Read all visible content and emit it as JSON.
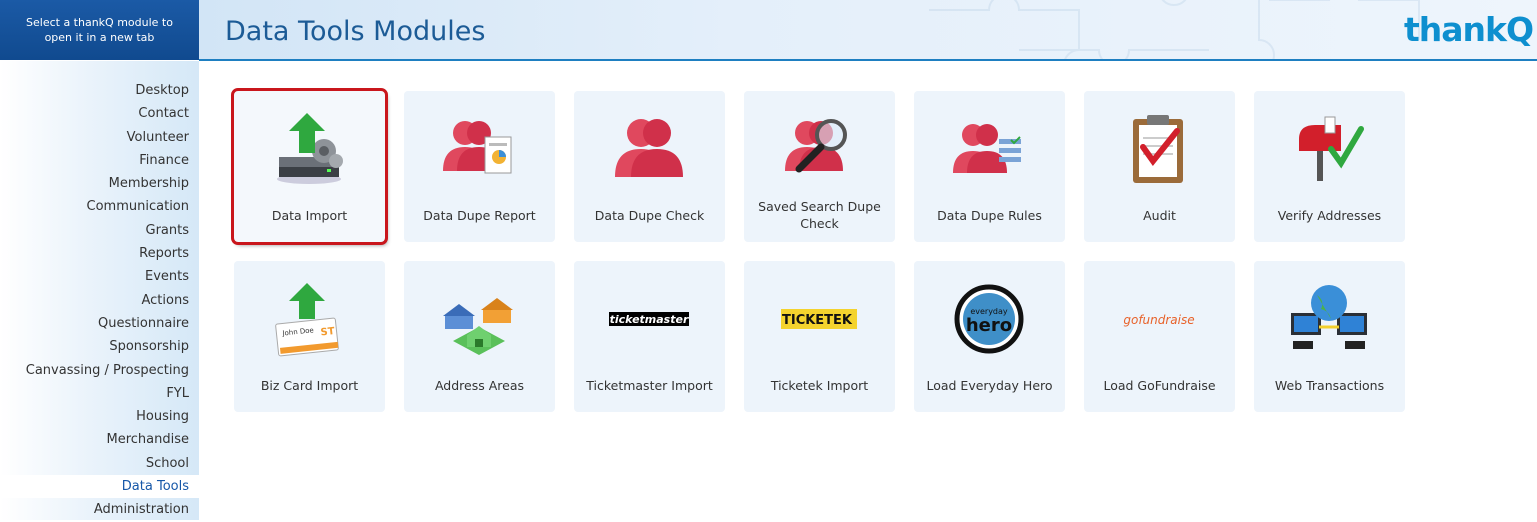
{
  "header": {
    "hint": "Select a thankQ module to open it in a new tab",
    "title": "Data Tools Modules",
    "logo": "thankQ"
  },
  "sidebar": {
    "items": [
      {
        "label": "Desktop"
      },
      {
        "label": "Contact"
      },
      {
        "label": "Volunteer"
      },
      {
        "label": "Finance"
      },
      {
        "label": "Membership"
      },
      {
        "label": "Communication"
      },
      {
        "label": "Grants"
      },
      {
        "label": "Reports"
      },
      {
        "label": "Events"
      },
      {
        "label": "Actions"
      },
      {
        "label": "Questionnaire"
      },
      {
        "label": "Sponsorship"
      },
      {
        "label": "Canvassing / Prospecting"
      },
      {
        "label": "FYL"
      },
      {
        "label": "Housing"
      },
      {
        "label": "Merchandise"
      },
      {
        "label": "School"
      },
      {
        "label": "Data Tools",
        "active": true
      },
      {
        "label": "Administration"
      }
    ]
  },
  "modules": [
    {
      "label": "Data Import",
      "icon": "data-import-icon",
      "selected": true
    },
    {
      "label": "Data Dupe Report",
      "icon": "dupe-report-icon"
    },
    {
      "label": "Data Dupe Check",
      "icon": "dupe-check-icon"
    },
    {
      "label": "Saved Search Dupe Check",
      "icon": "saved-search-icon"
    },
    {
      "label": "Data Dupe Rules",
      "icon": "dupe-rules-icon"
    },
    {
      "label": "Audit",
      "icon": "clipboard-check-icon"
    },
    {
      "label": "Verify Addresses",
      "icon": "mailbox-check-icon"
    },
    {
      "label": "Biz Card Import",
      "icon": "business-card-icon"
    },
    {
      "label": "Address Areas",
      "icon": "houses-icon"
    },
    {
      "label": "Ticketmaster Import",
      "icon": "ticketmaster-logo",
      "logo_text": "ticketmaster"
    },
    {
      "label": "Ticketek Import",
      "icon": "ticketek-logo",
      "logo_text": "TICKETEK"
    },
    {
      "label": "Load Everyday Hero",
      "icon": "everyday-hero-logo",
      "logo_text": "everyday hero"
    },
    {
      "label": "Load GoFundraise",
      "icon": "gofundraise-logo",
      "logo_text": "gofundraise"
    },
    {
      "label": "Web Transactions",
      "icon": "globe-network-icon"
    }
  ],
  "colors": {
    "accent": "#1e7fc1",
    "title": "#1c5b96",
    "selection": "#c9161c"
  }
}
